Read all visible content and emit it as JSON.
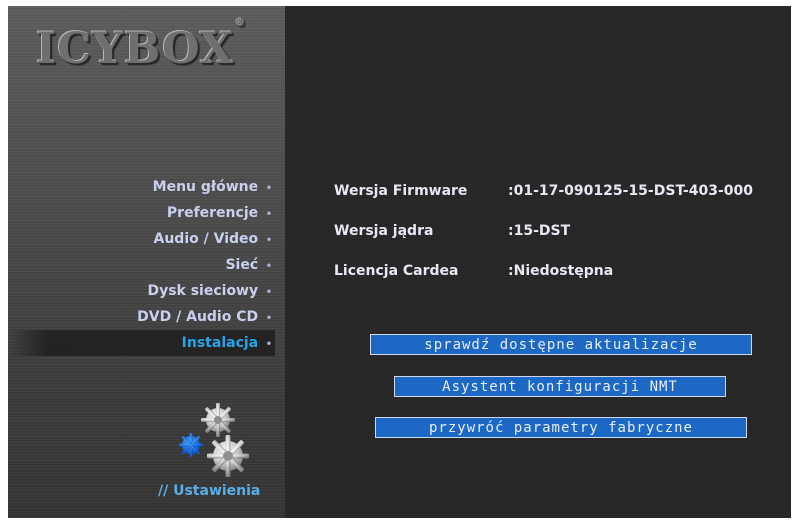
{
  "brand": {
    "logo_text": "ICYBOX",
    "logo_mark": "®"
  },
  "sidebar": {
    "items": [
      {
        "label": "Menu główne",
        "active": false
      },
      {
        "label": "Preferencje",
        "active": false
      },
      {
        "label": "Audio / Video",
        "active": false
      },
      {
        "label": "Sieć",
        "active": false
      },
      {
        "label": "Dysk sieciowy",
        "active": false
      },
      {
        "label": "DVD / Audio CD",
        "active": false
      },
      {
        "label": "Instalacja",
        "active": true
      }
    ],
    "bullet": "•",
    "section_label": "// Ustawienia",
    "section_icon": "gears-icon"
  },
  "info": {
    "rows": [
      {
        "label": "Wersja Firmware",
        "value": ":01-17-090125-15-DST-403-000"
      },
      {
        "label": "Wersja jądra",
        "value": ":15-DST"
      },
      {
        "label": "Licencja Cardea",
        "value": ":Niedostępna"
      }
    ]
  },
  "actions": {
    "check_updates": "sprawdź dostępne aktualizacje",
    "nmt_wizard": "Asystent konfiguracji NMT",
    "factory_reset": "przywróć parametry fabryczne"
  },
  "colors": {
    "accent_active": "#29a3e8",
    "button_bg": "#1c68c4",
    "menu_text": "#c9d0ee"
  }
}
